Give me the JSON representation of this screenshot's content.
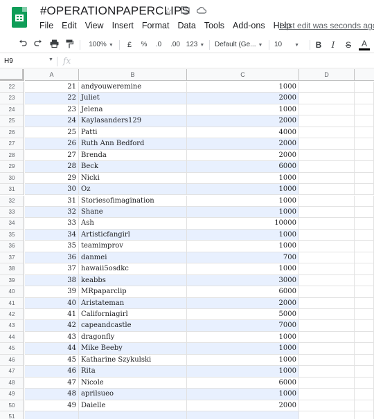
{
  "app": {
    "doc_title": "#OPERATIONPAPERCLIPS",
    "menu": [
      "File",
      "Edit",
      "View",
      "Insert",
      "Format",
      "Data",
      "Tools",
      "Add-ons",
      "Help"
    ],
    "last_edit": "Last edit was seconds ago"
  },
  "toolbar": {
    "zoom": "100%",
    "currency": "£",
    "percent": "%",
    "dec_less": ".0",
    "dec_more": ".00",
    "more_formats": "123",
    "font": "Default (Ge...",
    "font_size": "10",
    "bold": "B",
    "italic": "I",
    "strike": "S",
    "text_color": "A"
  },
  "formula_bar": {
    "cell_ref": "H9",
    "fx": "fx",
    "value": ""
  },
  "columns": [
    "A",
    "B",
    "C",
    "D"
  ],
  "rows": [
    {
      "n": "22",
      "a": "21",
      "b": "andyouweremine",
      "c": "1000"
    },
    {
      "n": "23",
      "a": "22",
      "b": "Juliet",
      "c": "2000"
    },
    {
      "n": "24",
      "a": "23",
      "b": "Jelena",
      "c": "1000"
    },
    {
      "n": "25",
      "a": "24",
      "b": "Kaylasanders129",
      "c": "2000"
    },
    {
      "n": "26",
      "a": "25",
      "b": "Patti",
      "c": "4000"
    },
    {
      "n": "27",
      "a": "26",
      "b": "Ruth Ann Bedford",
      "c": "2000"
    },
    {
      "n": "28",
      "a": "27",
      "b": "Brenda",
      "c": "2000"
    },
    {
      "n": "29",
      "a": "28",
      "b": "Beck",
      "c": "6000"
    },
    {
      "n": "30",
      "a": "29",
      "b": "Nicki",
      "c": "1000"
    },
    {
      "n": "31",
      "a": "30",
      "b": "Oz",
      "c": "1000"
    },
    {
      "n": "32",
      "a": "31",
      "b": "Storiesofimagination",
      "c": "1000"
    },
    {
      "n": "33",
      "a": "32",
      "b": "Shane",
      "c": "1000"
    },
    {
      "n": "34",
      "a": "33",
      "b": "Ash",
      "c": "10000"
    },
    {
      "n": "35",
      "a": "34",
      "b": "Artisticfangirl",
      "c": "1000"
    },
    {
      "n": "36",
      "a": "35",
      "b": "teamimprov",
      "c": "1000"
    },
    {
      "n": "37",
      "a": "36",
      "b": "danmei",
      "c": "700"
    },
    {
      "n": "38",
      "a": "37",
      "b": "hawaii5osdkc",
      "c": "1000"
    },
    {
      "n": "39",
      "a": "38",
      "b": "keabbs",
      "c": "3000"
    },
    {
      "n": "40",
      "a": "39",
      "b": "MRpaparclip",
      "c": "6000"
    },
    {
      "n": "41",
      "a": "40",
      "b": "Aristateman",
      "c": "2000"
    },
    {
      "n": "42",
      "a": "41",
      "b": "Californiagirl",
      "c": "5000"
    },
    {
      "n": "43",
      "a": "42",
      "b": "capeandcastle",
      "c": "7000"
    },
    {
      "n": "44",
      "a": "43",
      "b": "dragonfly",
      "c": "1000"
    },
    {
      "n": "45",
      "a": "44",
      "b": "Mike Beeby",
      "c": "1000"
    },
    {
      "n": "46",
      "a": "45",
      "b": "Katharine Szykulski",
      "c": "1000"
    },
    {
      "n": "47",
      "a": "46",
      "b": "Rita",
      "c": "1000"
    },
    {
      "n": "48",
      "a": "47",
      "b": "Nicole",
      "c": "6000"
    },
    {
      "n": "49",
      "a": "48",
      "b": "aprilsueo",
      "c": "1000"
    },
    {
      "n": "50",
      "a": "49",
      "b": "Daielle",
      "c": "2000"
    },
    {
      "n": "51",
      "a": "",
      "b": "",
      "c": ""
    }
  ],
  "colors": {
    "logo": "#0f9d58",
    "band": "#e8f0fe",
    "header_bg": "#f8f9fa"
  },
  "icons": [
    "star-icon",
    "move-to-folder-icon",
    "cloud-saved-icon",
    "undo-icon",
    "redo-icon",
    "print-icon",
    "paint-format-icon",
    "caret-down-icon"
  ]
}
